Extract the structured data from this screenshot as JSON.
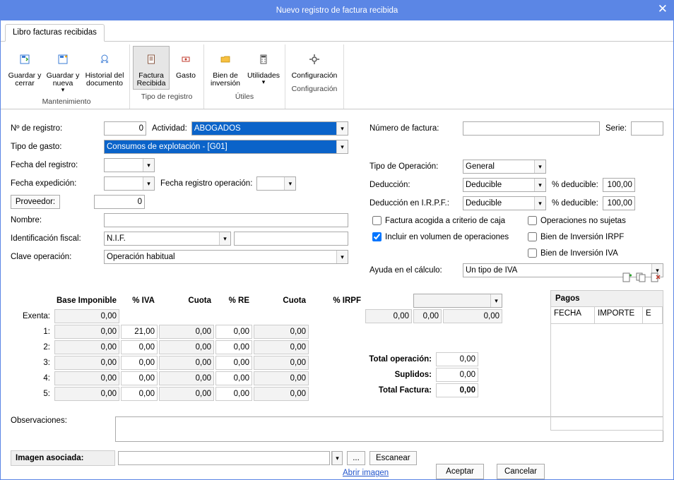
{
  "titlebar": {
    "title": "Nuevo registro de factura recibida"
  },
  "tabstrip": {
    "tab": "Libro facturas recibidas"
  },
  "ribbon": {
    "groups": [
      {
        "label": "Mantenimiento",
        "buttons": [
          {
            "label": "Guardar y cerrar"
          },
          {
            "label": "Guardar y nueva",
            "dropdown": true
          },
          {
            "label": "Historial del documento"
          }
        ]
      },
      {
        "label": "Tipo de registro",
        "buttons": [
          {
            "label": "Factura Recibida",
            "selected": true
          },
          {
            "label": "Gasto"
          }
        ]
      },
      {
        "label": "Útiles",
        "buttons": [
          {
            "label": "Bien de inversión"
          },
          {
            "label": "Utilidades",
            "dropdown": true
          }
        ]
      },
      {
        "label": "Configuración",
        "buttons": [
          {
            "label": "Configuración"
          }
        ]
      }
    ]
  },
  "left": {
    "n_registro_label": "Nº de registro:",
    "n_registro": "0",
    "actividad_label": "Actividad:",
    "actividad": "ABOGADOS",
    "tipo_gasto_label": "Tipo de gasto:",
    "tipo_gasto": "Consumos de explotación - [G01]",
    "fecha_registro_label": "Fecha del registro:",
    "fecha_expedicion_label": "Fecha expedición:",
    "fecha_registro_op_label": "Fecha registro operación:",
    "proveedor_btn": "Proveedor:",
    "proveedor_val": "0",
    "nombre_label": "Nombre:",
    "id_fiscal_label": "Identificación fiscal:",
    "id_fiscal_type": "N.I.F.",
    "clave_op_label": "Clave operación:",
    "clave_op": "Operación habitual"
  },
  "right": {
    "num_factura_label": "Número de factura:",
    "serie_label": "Serie:",
    "tipo_op_label": "Tipo de Operación:",
    "tipo_op": "General",
    "deduccion_label": "Deducción:",
    "deduccion": "Deducible",
    "pct_deducible_label": "% deducible:",
    "pct_deducible_1": "100,00",
    "ded_irpf_label": "Deducción en I.R.P.F.:",
    "ded_irpf": "Deducible",
    "pct_deducible_2": "100,00",
    "chk_criterio_caja": "Factura acogida a criterio de caja",
    "chk_op_no_sujetas": "Operaciones no sujetas",
    "chk_incluir_vol": "Incluir en  volumen de operaciones",
    "chk_bien_inv_irpf": "Bien de Inversión IRPF",
    "chk_bien_inv_iva": "Bien de Inversión IVA",
    "ayuda_calc_label": "Ayuda en el cálculo:",
    "ayuda_calc": "Un tipo de IVA"
  },
  "grid": {
    "headers": {
      "base": "Base Imponible",
      "pct_iva": "% IVA",
      "cuota_iva": "Cuota",
      "pct_re": "% RE",
      "cuota_re": "Cuota",
      "pct_irpf": "% IRPF"
    },
    "rowlabels": [
      "Exenta:",
      "1:",
      "2:",
      "3:",
      "4:",
      "5:"
    ],
    "exenta": {
      "base": "0,00"
    },
    "rows": [
      {
        "base": "0,00",
        "piva": "21,00",
        "civa": "0,00",
        "pre": "0,00",
        "cre": "0,00"
      },
      {
        "base": "0,00",
        "piva": "0,00",
        "civa": "0,00",
        "pre": "0,00",
        "cre": "0,00"
      },
      {
        "base": "0,00",
        "piva": "0,00",
        "civa": "0,00",
        "pre": "0,00",
        "cre": "0,00"
      },
      {
        "base": "0,00",
        "piva": "0,00",
        "civa": "0,00",
        "pre": "0,00",
        "cre": "0,00"
      },
      {
        "base": "0,00",
        "piva": "0,00",
        "civa": "0,00",
        "pre": "0,00",
        "cre": "0,00"
      }
    ],
    "irpf_row": {
      "pct": "0,00",
      "a": "0,00",
      "b": "0,00"
    }
  },
  "totals": {
    "total_op_label": "Total operación:",
    "total_op": "0,00",
    "suplidos_label": "Suplidos:",
    "suplidos": "0,00",
    "total_factura_label": "Total Factura:",
    "total_factura": "0,00"
  },
  "observaciones_label": "Observaciones:",
  "imagen_label": "Imagen asociada:",
  "abrir_imagen": "Abrir imagen",
  "escanear": "Escanear",
  "dots": "...",
  "aceptar": "Aceptar",
  "cancelar": "Cancelar",
  "pagos": {
    "title": "Pagos",
    "col_fecha": "FECHA",
    "col_importe": "IMPORTE",
    "col_e": "E"
  }
}
